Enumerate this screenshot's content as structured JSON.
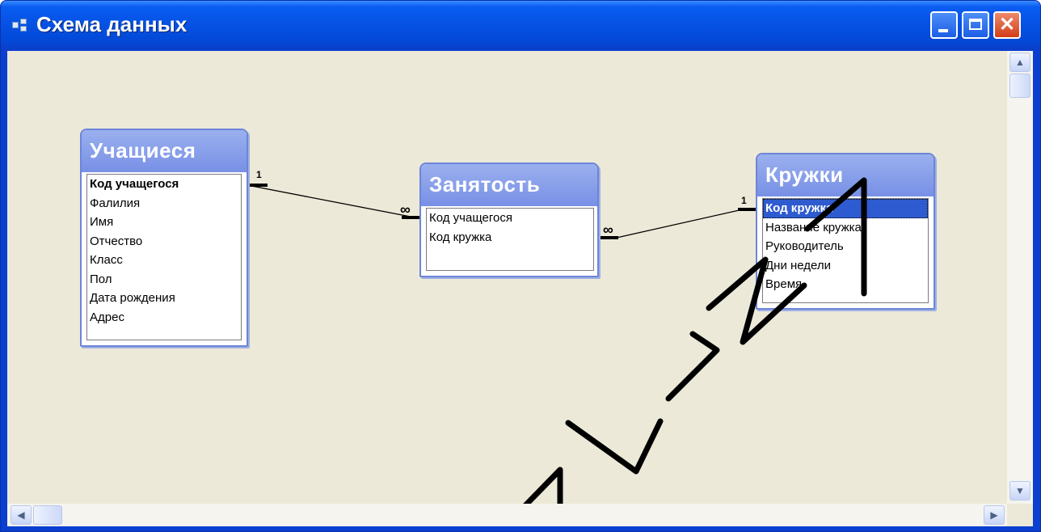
{
  "window": {
    "title": "Схема данных",
    "colors": {
      "titlebar": "#0551e3",
      "client": "#ece9d8",
      "table_header": "#7890e6",
      "selection": "#2e5bcf"
    }
  },
  "controls": {
    "minimize_icon": "minimize-icon",
    "maximize_icon": "maximize-icon",
    "close_glyph": "✕"
  },
  "tables": {
    "students": {
      "title": "Учащиеся",
      "fields": [
        "Код учащегося",
        "Фалилия",
        "Имя",
        "Отчество",
        "Класс",
        "Пол",
        "Дата рождения",
        "Адрес"
      ]
    },
    "activity": {
      "title": "Занятость",
      "fields": [
        "Код учащегося",
        "Код кружка"
      ]
    },
    "clubs": {
      "title": "Кружки",
      "fields": [
        "Код кружка",
        "Название кружка",
        "Руководитель",
        "Дни недели",
        "Время"
      ]
    }
  },
  "relationships": [
    {
      "from": "Учащиеся.Код учащегося",
      "to": "Занятость.Код учащегося",
      "one": "1",
      "many": "∞"
    },
    {
      "from": "Кружки.Код кружка",
      "to": "Занятость.Код кружка",
      "one": "1",
      "many": "∞"
    }
  ],
  "scrollbars": {
    "up": "▲",
    "down": "▼",
    "left": "◀",
    "right": "▶"
  },
  "watermark": "ЙИ БГУКИ"
}
